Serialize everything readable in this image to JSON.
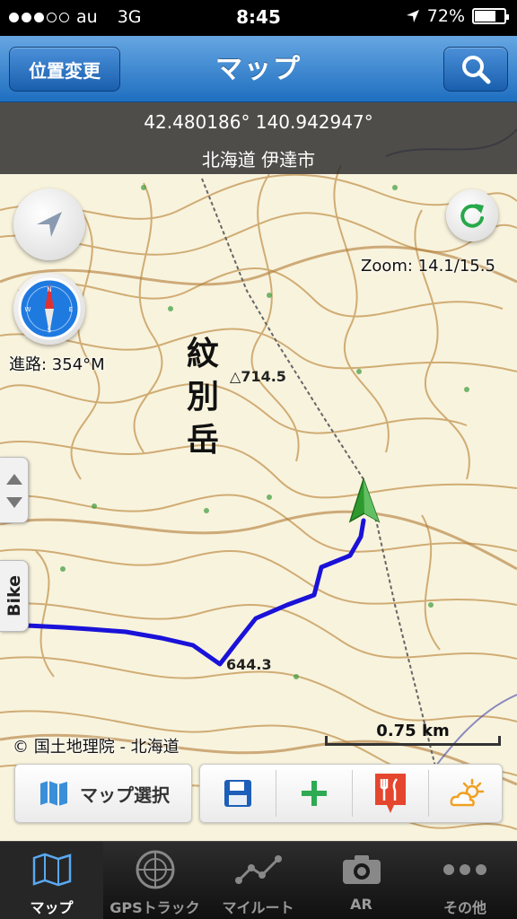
{
  "status_bar": {
    "carrier": "au",
    "network": "3G",
    "time": "8:45",
    "battery": "72%",
    "battery_level": 0.72,
    "signal_bars_filled": 3,
    "signal_bars_total": 5
  },
  "nav": {
    "left_button": "位置変更",
    "title": "マップ",
    "right_icon": "search-icon"
  },
  "map": {
    "coordinates": "42.480186° 140.942947°",
    "place": "北海道 伊達市",
    "zoom": "Zoom: 14.1/15.5",
    "heading": "進路: 354°M",
    "mountain_name": [
      "紋",
      "別",
      "岳"
    ],
    "elevation_peak": "714.5",
    "elevation_low": "644.3",
    "copyright": "© 国土地理院 - 北海道",
    "scale": "0.75 km",
    "side_tab": "Bike",
    "track_color": "#1a12d8",
    "marker_color": "#2e9a2e"
  },
  "toolbar": {
    "map_select": "マップ選択",
    "icons": [
      "save-icon",
      "add-icon",
      "restaurant-icon",
      "weather-icon"
    ]
  },
  "tabs": [
    {
      "label": "マップ",
      "icon": "map-icon",
      "active": true
    },
    {
      "label": "GPSトラック",
      "icon": "radar-icon",
      "active": false
    },
    {
      "label": "マイルート",
      "icon": "route-icon",
      "active": false
    },
    {
      "label": "AR",
      "icon": "camera-icon",
      "active": false
    },
    {
      "label": "その他",
      "icon": "more-icon",
      "active": false
    }
  ]
}
